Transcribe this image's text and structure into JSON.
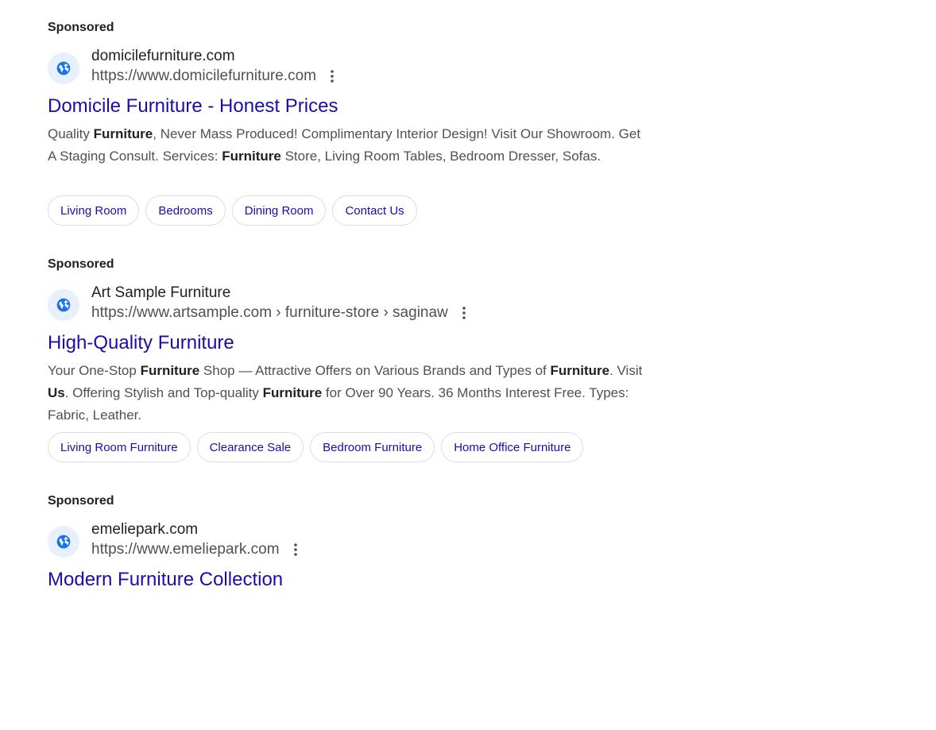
{
  "ads": [
    {
      "sponsored_label": "Sponsored",
      "favicon": "globe-icon",
      "site_name": "domicilefurniture.com",
      "url": "https://www.domicilefurniture.com",
      "headline": "Domicile Furniture - Honest Prices",
      "description_segments": [
        {
          "text": "Quality ",
          "bold": false
        },
        {
          "text": "Furniture",
          "bold": true
        },
        {
          "text": ", Never Mass Produced! Complimentary Interior Design! Visit Our Showroom. Get A Staging Consult. Services: ",
          "bold": false
        },
        {
          "text": "Furniture",
          "bold": true
        },
        {
          "text": " Store, Living Room Tables, Bedroom Dresser, Sofas.",
          "bold": false
        }
      ],
      "sitelinks": [
        "Living Room",
        "Bedrooms",
        "Dining Room",
        "Contact Us"
      ]
    },
    {
      "sponsored_label": "Sponsored",
      "favicon": "globe-icon",
      "site_name": "Art Sample Furniture",
      "url": "https://www.artsample.com › furniture-store › saginaw",
      "headline": "High-Quality Furniture",
      "description_segments": [
        {
          "text": "Your One-Stop ",
          "bold": false
        },
        {
          "text": "Furniture",
          "bold": true
        },
        {
          "text": " Shop — Attractive Offers on Various Brands and Types of ",
          "bold": false
        },
        {
          "text": "Furniture",
          "bold": true
        },
        {
          "text": ". Visit ",
          "bold": false
        },
        {
          "text": "Us",
          "bold": true
        },
        {
          "text": ". Offering Stylish and Top-quality ",
          "bold": false
        },
        {
          "text": "Furniture",
          "bold": true
        },
        {
          "text": " for Over 90 Years. 36 Months Interest Free. Types: Fabric, Leather.",
          "bold": false
        }
      ],
      "sitelinks": [
        "Living Room Furniture",
        "Clearance Sale",
        "Bedroom Furniture",
        "Home Office Furniture"
      ]
    },
    {
      "sponsored_label": "Sponsored",
      "favicon": "globe-icon",
      "site_name": "emeliepark.com",
      "url": "https://www.emeliepark.com",
      "headline": "Modern Furniture Collection",
      "description_segments": [],
      "sitelinks": []
    }
  ],
  "colors": {
    "link": "#1a0dab",
    "url_text": "#4d5156",
    "favicon_bg": "#e8f0fe",
    "favicon_fg": "#1a73e8"
  }
}
